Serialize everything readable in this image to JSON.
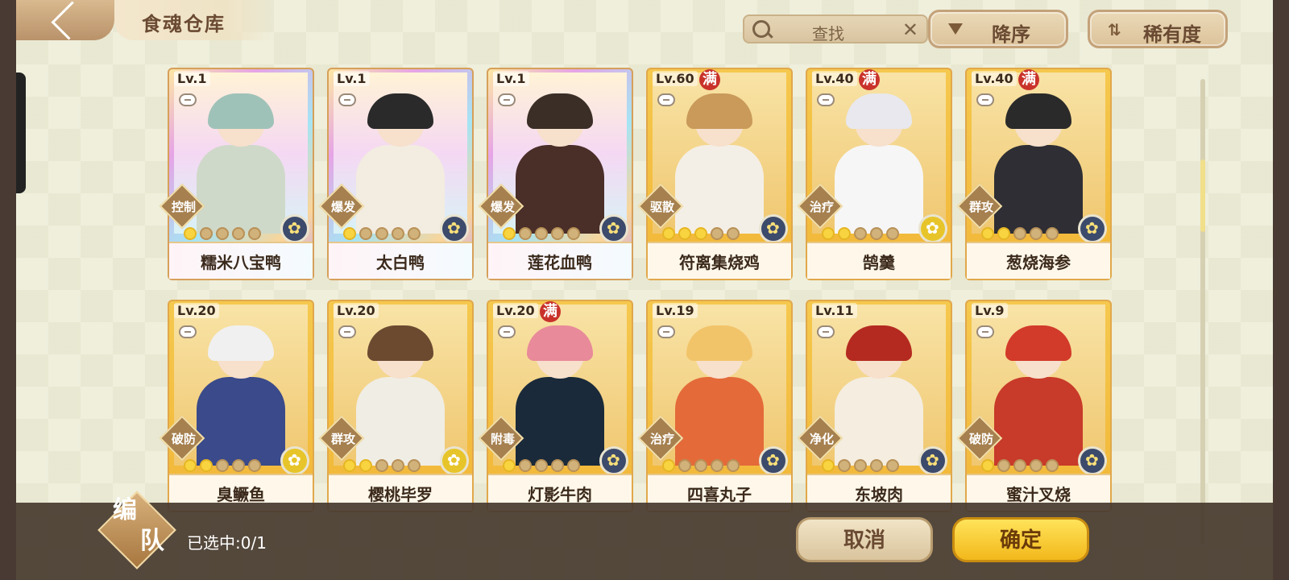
{
  "header": {
    "title": "食魂仓库",
    "search_placeholder": "查找",
    "sort_label": "降序",
    "rarity_label": "稀有度"
  },
  "cards": [
    {
      "level": "Lv.1",
      "full": false,
      "role": "控制",
      "stars_filled": 1,
      "stars_total": 5,
      "name": "糯米八宝鸭",
      "rare": true,
      "elem": "blue"
    },
    {
      "level": "Lv.1",
      "full": false,
      "role": "爆发",
      "stars_filled": 1,
      "stars_total": 5,
      "name": "太白鸭",
      "rare": true,
      "elem": "blue"
    },
    {
      "level": "Lv.1",
      "full": false,
      "role": "爆发",
      "stars_filled": 1,
      "stars_total": 5,
      "name": "莲花血鸭",
      "rare": true,
      "elem": "blue"
    },
    {
      "level": "Lv.60",
      "full": true,
      "full_label": "满",
      "role": "驱散",
      "stars_filled": 3,
      "stars_total": 5,
      "name": "符离集烧鸡",
      "rare": false,
      "elem": "blue"
    },
    {
      "level": "Lv.40",
      "full": true,
      "full_label": "满",
      "role": "治疗",
      "stars_filled": 2,
      "stars_total": 5,
      "name": "鹄羹",
      "rare": false,
      "elem": "gold"
    },
    {
      "level": "Lv.40",
      "full": true,
      "full_label": "满",
      "role": "群攻",
      "stars_filled": 2,
      "stars_total": 5,
      "name": "葱烧海参",
      "rare": false,
      "elem": "blue"
    },
    {
      "level": "Lv.20",
      "full": false,
      "role": "破防",
      "stars_filled": 2,
      "stars_total": 5,
      "name": "臭鳜鱼",
      "rare": false,
      "elem": "gold"
    },
    {
      "level": "Lv.20",
      "full": false,
      "role": "群攻",
      "stars_filled": 2,
      "stars_total": 5,
      "name": "樱桃毕罗",
      "rare": false,
      "elem": "gold"
    },
    {
      "level": "Lv.20",
      "full": true,
      "full_label": "满",
      "role": "附毒",
      "stars_filled": 1,
      "stars_total": 5,
      "name": "灯影牛肉",
      "rare": false,
      "elem": "blue"
    },
    {
      "level": "Lv.19",
      "full": false,
      "role": "治疗",
      "stars_filled": 1,
      "stars_total": 5,
      "name": "四喜丸子",
      "rare": false,
      "elem": "blue"
    },
    {
      "level": "Lv.11",
      "full": false,
      "role": "净化",
      "stars_filled": 1,
      "stars_total": 5,
      "name": "东坡肉",
      "rare": false,
      "elem": "blue"
    },
    {
      "level": "Lv.9",
      "full": false,
      "role": "破防",
      "stars_filled": 1,
      "stars_total": 5,
      "name": "蜜汁叉烧",
      "rare": false,
      "elem": "blue"
    }
  ],
  "footer": {
    "team_label_1": "编",
    "team_label_2": "队",
    "selected_text": "已选中:0/1",
    "cancel_label": "取消",
    "confirm_label": "确定"
  },
  "colors": {
    "gold_card": "#f5c84e",
    "confirm": "#f7c934",
    "bottom_bar": "#463a2e"
  }
}
